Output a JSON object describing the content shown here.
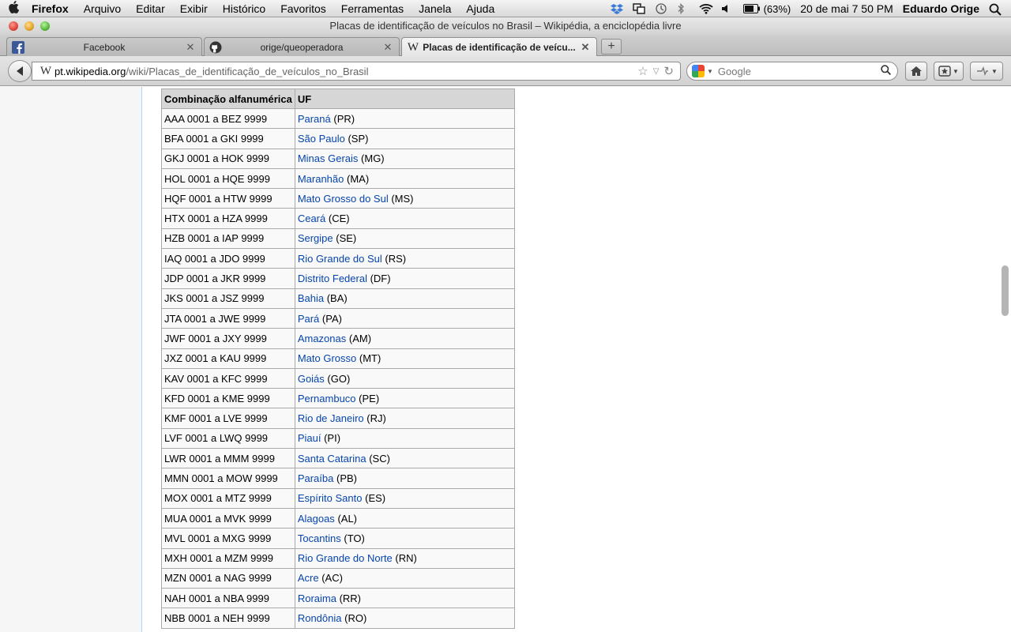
{
  "menubar": {
    "app": "Firefox",
    "items": [
      "Arquivo",
      "Editar",
      "Exibir",
      "Histórico",
      "Favoritos",
      "Ferramentas",
      "Janela",
      "Ajuda"
    ],
    "battery": "(63%)",
    "datetime": "20 de mai  7 50 PM",
    "user": "Eduardo Orige"
  },
  "window": {
    "title": "Placas de identificação de veículos no Brasil – Wikipédia, a enciclopédia livre"
  },
  "tabs": [
    {
      "label": "Facebook",
      "icon": "facebook-icon"
    },
    {
      "label": "orige/queoperadora",
      "icon": "github-icon"
    },
    {
      "label": "Placas de identificação de veícu...",
      "icon": "wikipedia-icon"
    }
  ],
  "nav": {
    "url_domain": "pt.wikipedia.org",
    "url_path": "/wiki/Placas_de_identificação_de_veículos_no_Brasil",
    "search_placeholder": "Google"
  },
  "table": {
    "headers": [
      "Combinação alfanumérica",
      "UF"
    ],
    "rows": [
      {
        "range": "AAA 0001 a BEZ 9999",
        "state": "Paraná",
        "uf": "(PR)"
      },
      {
        "range": "BFA 0001 a GKI 9999",
        "state": "São Paulo",
        "uf": "(SP)"
      },
      {
        "range": "GKJ 0001 a HOK 9999",
        "state": "Minas Gerais",
        "uf": "(MG)"
      },
      {
        "range": "HOL 0001 a HQE 9999",
        "state": "Maranhão",
        "uf": "(MA)"
      },
      {
        "range": "HQF 0001 a HTW 9999",
        "state": "Mato Grosso do Sul",
        "uf": "(MS)"
      },
      {
        "range": "HTX 0001 a HZA 9999",
        "state": "Ceará",
        "uf": "(CE)"
      },
      {
        "range": "HZB 0001 a IAP 9999",
        "state": "Sergipe",
        "uf": "(SE)"
      },
      {
        "range": "IAQ 0001 a JDO 9999",
        "state": "Rio Grande do Sul",
        "uf": "(RS)"
      },
      {
        "range": "JDP 0001 a JKR 9999",
        "state": "Distrito Federal",
        "uf": "(DF)"
      },
      {
        "range": "JKS 0001 a JSZ 9999",
        "state": "Bahia",
        "uf": "(BA)"
      },
      {
        "range": "JTA 0001 a JWE 9999",
        "state": "Pará",
        "uf": "(PA)"
      },
      {
        "range": "JWF 0001 a JXY 9999",
        "state": "Amazonas",
        "uf": "(AM)"
      },
      {
        "range": "JXZ 0001 a KAU 9999",
        "state": "Mato Grosso",
        "uf": "(MT)"
      },
      {
        "range": "KAV 0001 a KFC 9999",
        "state": "Goiás",
        "uf": "(GO)"
      },
      {
        "range": "KFD 0001 a KME 9999",
        "state": "Pernambuco",
        "uf": "(PE)"
      },
      {
        "range": "KMF 0001 a LVE 9999",
        "state": "Rio de Janeiro",
        "uf": "(RJ)"
      },
      {
        "range": "LVF 0001 a LWQ 9999",
        "state": "Piauí",
        "uf": "(PI)"
      },
      {
        "range": "LWR 0001 a MMM 9999",
        "state": "Santa Catarina",
        "uf": "(SC)"
      },
      {
        "range": "MMN 0001 a MOW 9999",
        "state": "Paraíba",
        "uf": "(PB)"
      },
      {
        "range": "MOX 0001 a MTZ 9999",
        "state": "Espírito Santo",
        "uf": "(ES)"
      },
      {
        "range": "MUA 0001 a MVK 9999",
        "state": "Alagoas",
        "uf": "(AL)"
      },
      {
        "range": "MVL 0001 a MXG 9999",
        "state": "Tocantins",
        "uf": "(TO)"
      },
      {
        "range": "MXH 0001 a MZM 9999",
        "state": "Rio Grande do Norte",
        "uf": "(RN)"
      },
      {
        "range": "MZN 0001 a NAG 9999",
        "state": "Acre",
        "uf": "(AC)"
      },
      {
        "range": "NAH 0001 a NBA 9999",
        "state": "Roraima",
        "uf": "(RR)"
      },
      {
        "range": "NBB 0001 a NEH 9999",
        "state": "Rondônia",
        "uf": "(RO)"
      }
    ]
  },
  "colors": {
    "link": "#0645ad",
    "table_header": "#d6d6d6",
    "table_border": "#aaaaaa"
  }
}
